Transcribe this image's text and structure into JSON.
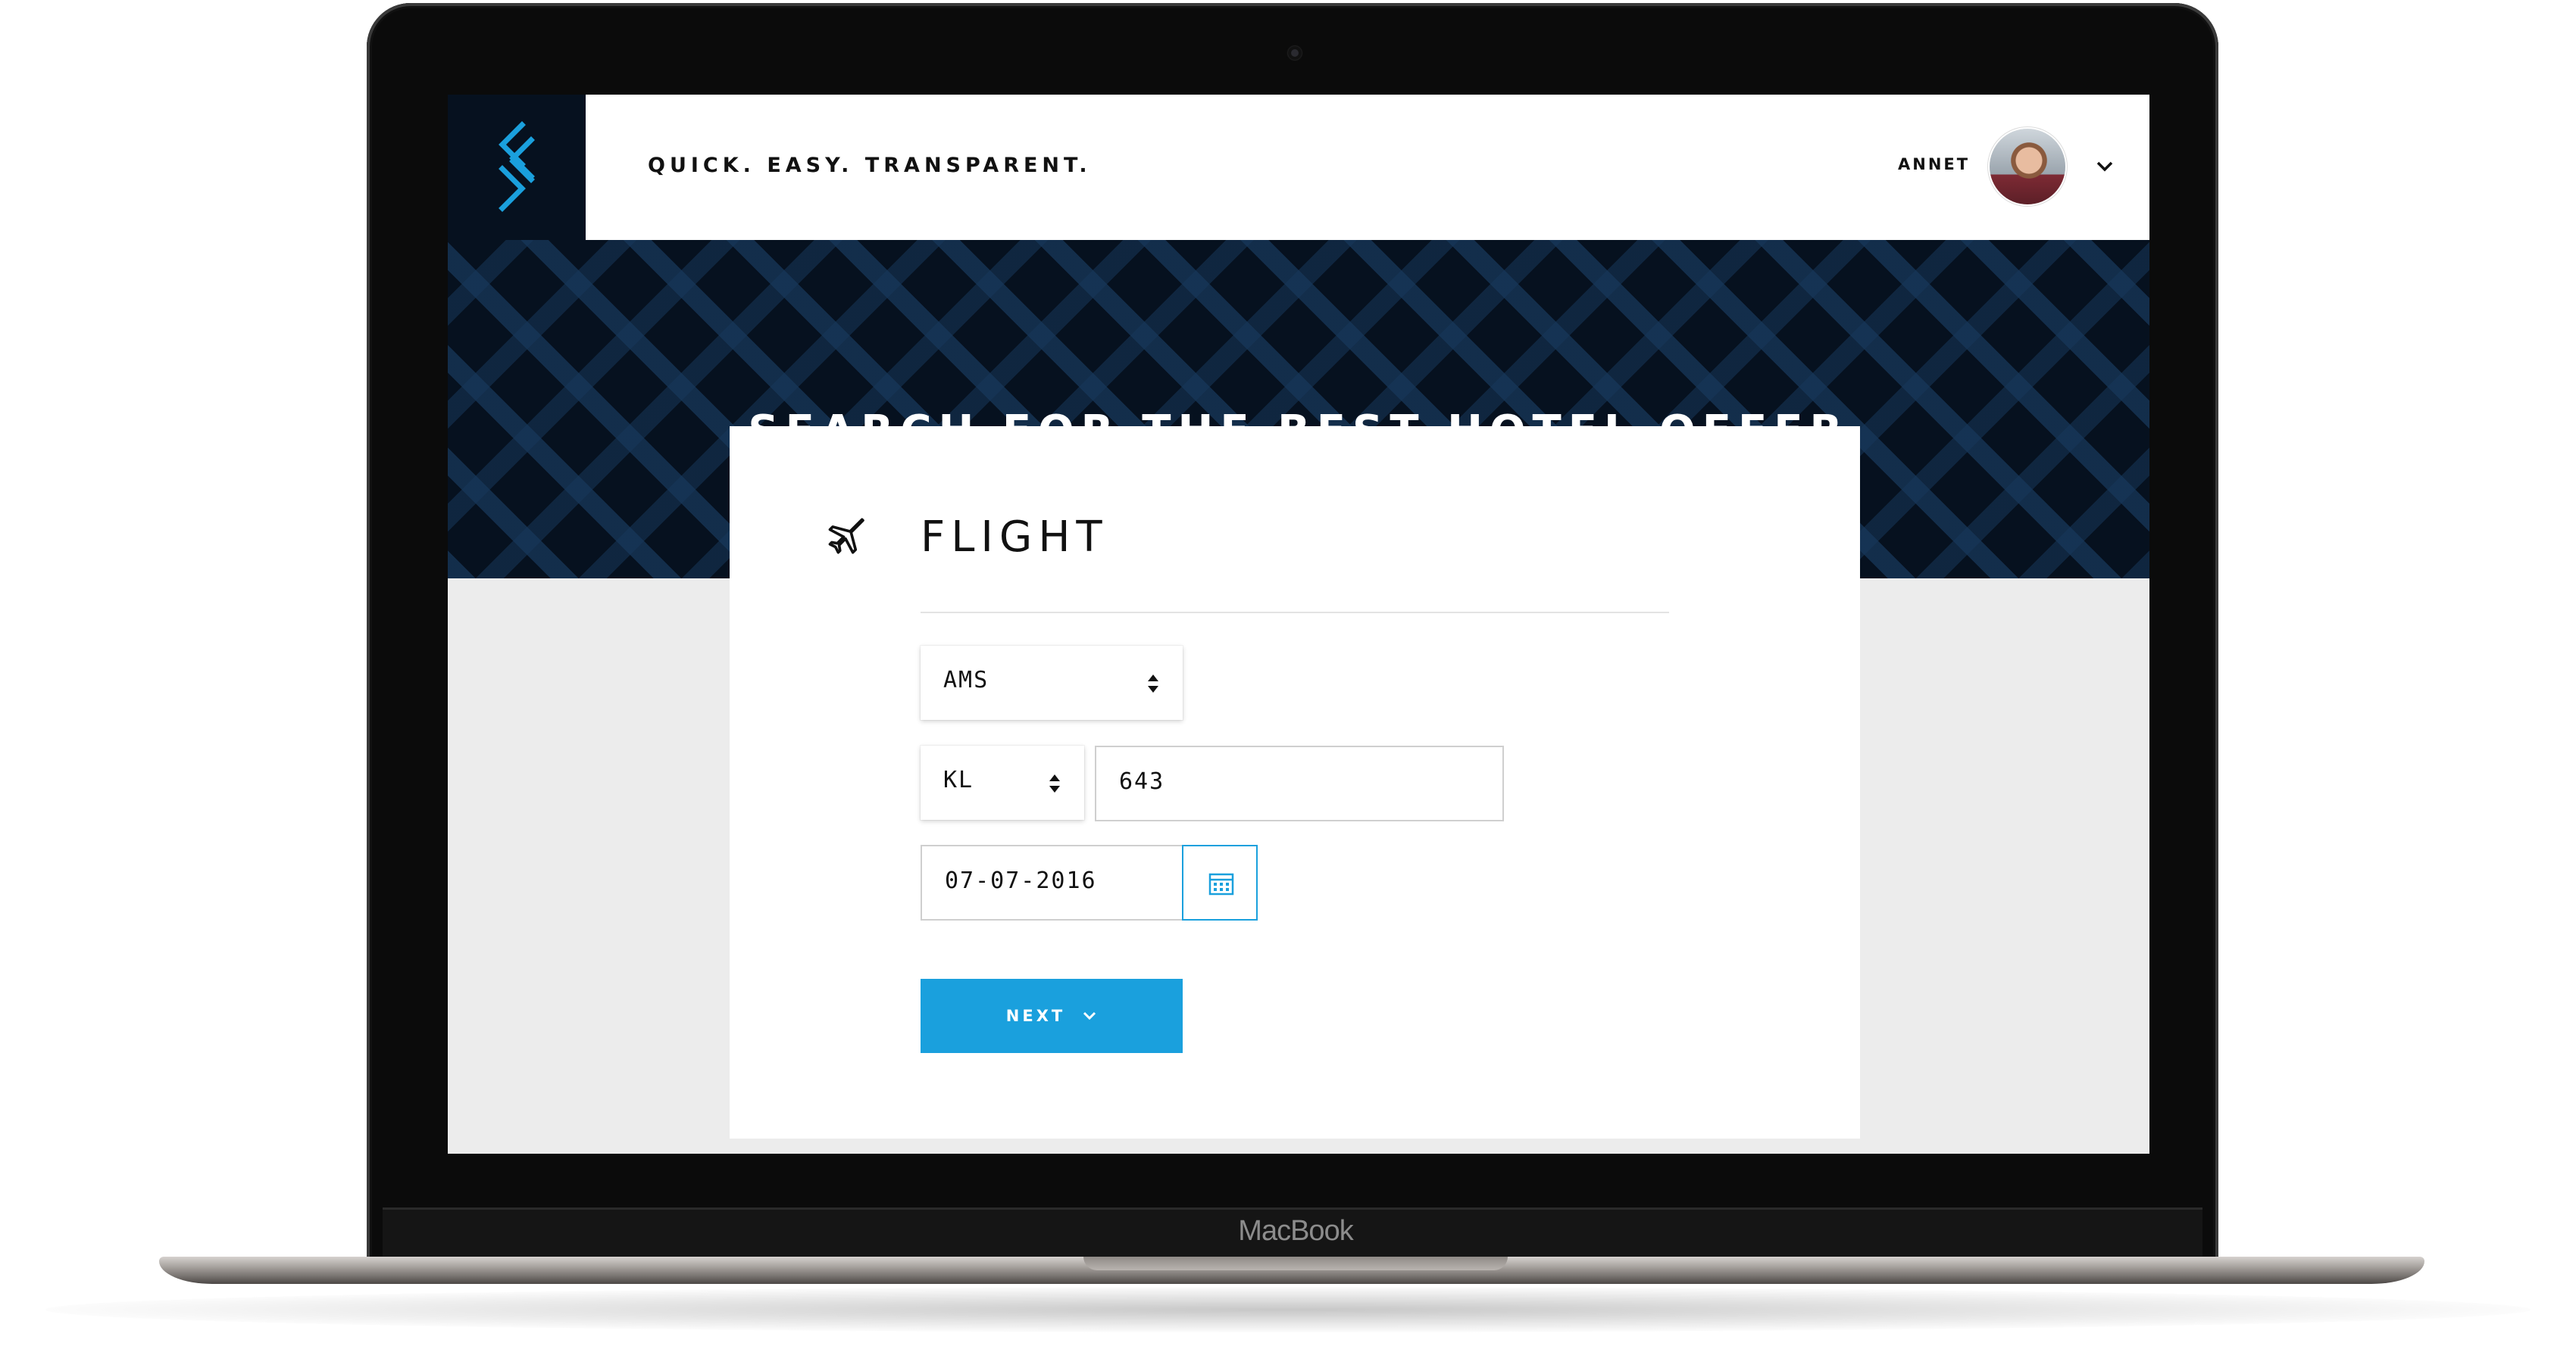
{
  "app": {
    "tagline": "QUICK. EASY. TRANSPARENT.",
    "user": {
      "name": "ANNET",
      "avatar_icon": "user-avatar",
      "menu_icon": "chevron-down-icon"
    },
    "logo_icon": "brand-chevrons-logo"
  },
  "hero": {
    "title": "SEARCH FOR THE BEST HOTEL OFFER"
  },
  "form": {
    "section_title": "FLIGHT",
    "section_icon": "airplane-icon",
    "airport_select": {
      "value": "AMS",
      "icon": "sort-arrows-icon"
    },
    "airline_select": {
      "value": "KL",
      "icon": "sort-arrows-icon"
    },
    "flight_number": {
      "value": "643"
    },
    "date": {
      "value": "07-07-2016",
      "icon": "calendar-icon"
    },
    "next_button": {
      "label": "NEXT",
      "icon": "chevron-down-icon"
    }
  },
  "device": {
    "brand": "MacBook"
  },
  "colors": {
    "navy": "#06111f",
    "pattern": "#17375a",
    "accent": "#1aa0dd",
    "screen_bg": "#ececec"
  }
}
